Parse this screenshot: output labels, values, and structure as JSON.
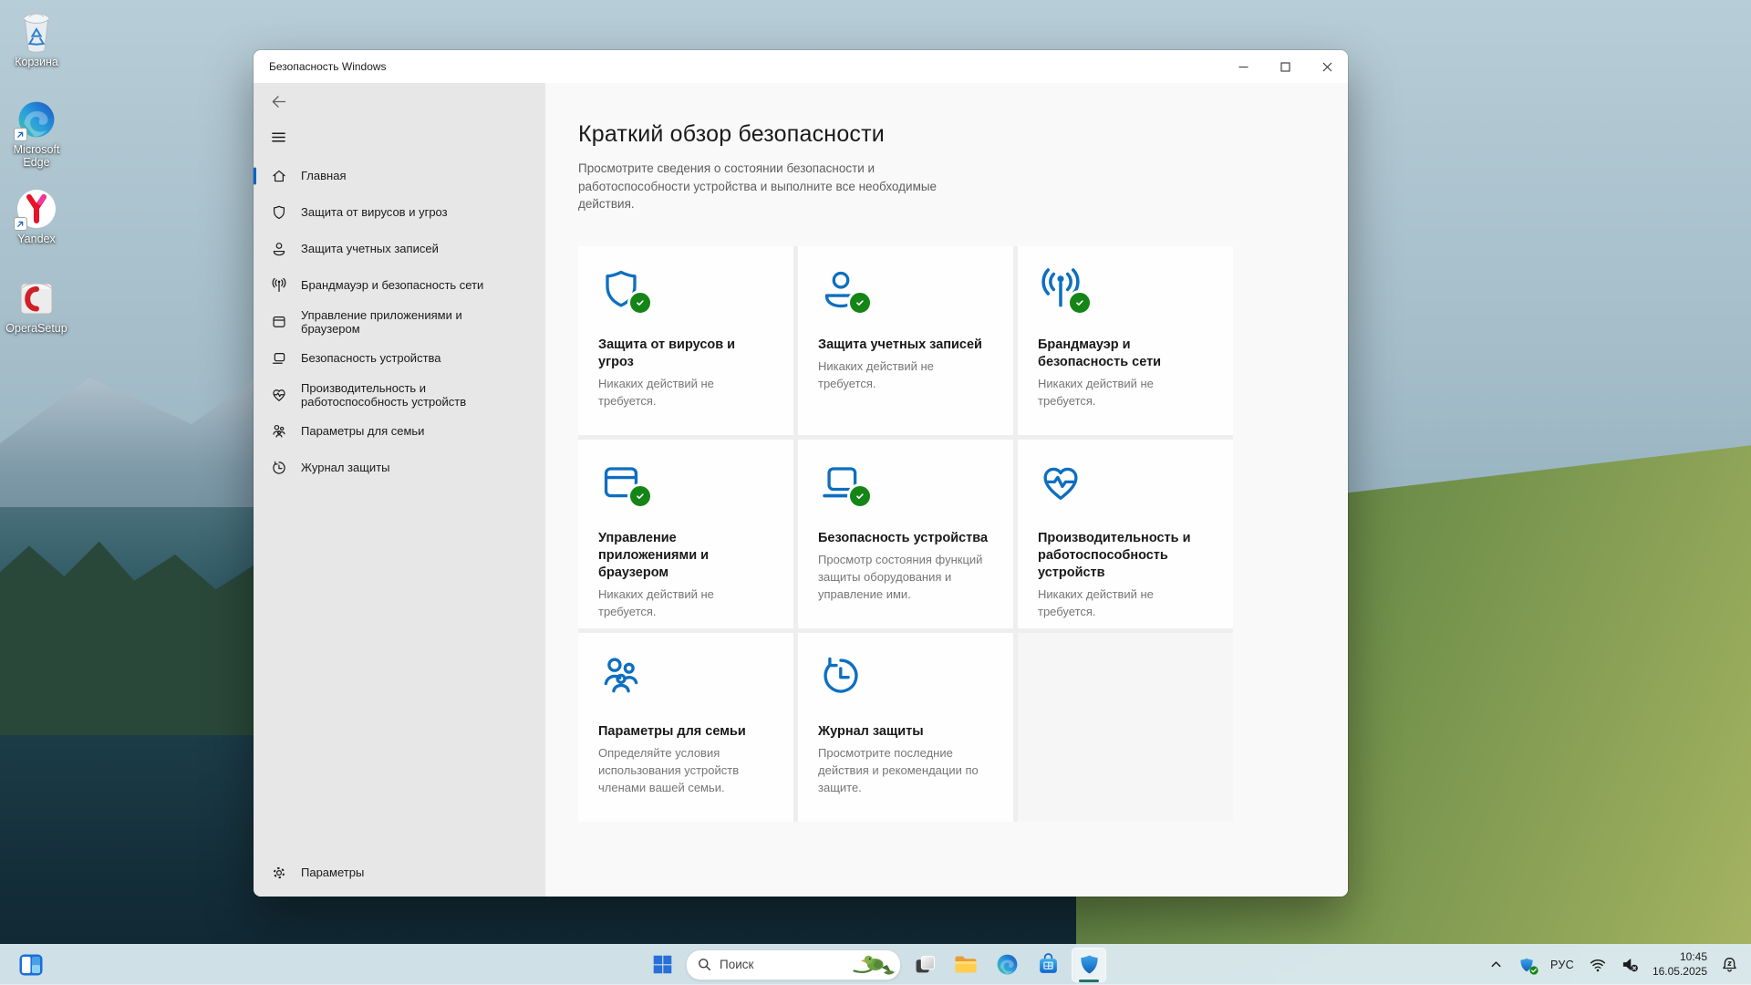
{
  "window": {
    "title": "Безопасность Windows",
    "sidebar": {
      "items": [
        {
          "label": "Главная",
          "icon": "home-icon",
          "selected": true
        },
        {
          "label": "Защита от вирусов и угроз",
          "icon": "virus-shield-icon",
          "selected": false
        },
        {
          "label": "Защита учетных записей",
          "icon": "account-icon",
          "selected": false
        },
        {
          "label": "Брандмауэр и безопасность сети",
          "icon": "firewall-antenna-icon",
          "selected": false
        },
        {
          "label": "Управление приложениями и\nбраузером",
          "icon": "app-browser-icon",
          "selected": false
        },
        {
          "label": "Безопасность устройства",
          "icon": "device-laptop-icon",
          "selected": false
        },
        {
          "label": "Производительность и\nработоспособность устройств",
          "icon": "health-heart-icon",
          "selected": false
        },
        {
          "label": "Параметры для семьи",
          "icon": "family-icon",
          "selected": false
        },
        {
          "label": "Журнал защиты",
          "icon": "history-clock-icon",
          "selected": false
        }
      ],
      "settings_label": "Параметры",
      "settings_icon": "gear-icon"
    },
    "main": {
      "heading": "Краткий обзор безопасности",
      "description": "Просмотрите сведения о состоянии безопасности и\nработоспособности устройства и выполните все необходимые\nдействия.",
      "cards": [
        {
          "title": "Защита от вирусов и угроз",
          "status": "Никаких действий не\nтребуется.",
          "icon": "virus-shield-icon",
          "check": true
        },
        {
          "title": "Защита учетных записей",
          "status": "Никаких действий не\nтребуется.",
          "icon": "account-icon",
          "check": true
        },
        {
          "title": "Брандмауэр и\nбезопасность сети",
          "status": "Никаких действий не\nтребуется.",
          "icon": "firewall-antenna-icon",
          "check": true
        },
        {
          "title": "Управление\nприложениями и\nбраузером",
          "status": "Никаких действий не\nтребуется.",
          "icon": "app-browser-icon",
          "check": true
        },
        {
          "title": "Безопасность устройства",
          "status": "Просмотр состояния функций\nзащиты оборудования и\nуправление ими.",
          "icon": "device-laptop-icon",
          "check": true
        },
        {
          "title": "Производительность и\nработоспособность\nустройств",
          "status": "Никаких действий не\nтребуется.",
          "icon": "health-heart-icon",
          "check": false
        },
        {
          "title": "Параметры для семьи",
          "status": "Определяйте условия\nиспользования устройств\nчленами вашей семьи.",
          "icon": "family-icon",
          "check": false
        },
        {
          "title": "Журнал защиты",
          "status": "Просмотрите последние\nдействия и рекомендации по\nзащите.",
          "icon": "history-clock-icon",
          "check": false
        }
      ]
    }
  },
  "desktop": {
    "icons": [
      {
        "label": "Корзина",
        "icon": "recycle-bin-icon"
      },
      {
        "label": "Microsoft\nEdge",
        "icon": "edge-icon"
      },
      {
        "label": "Yandex",
        "icon": "yandex-icon"
      },
      {
        "label": "OperaSetup",
        "icon": "opera-setup-icon"
      }
    ]
  },
  "taskbar": {
    "search_placeholder": "Поиск",
    "buttons": [
      "widgets",
      "start",
      "search",
      "task-view",
      "file-explorer",
      "edge",
      "store",
      "windows-security"
    ],
    "active_button": "windows-security",
    "tray": {
      "language": "РУС",
      "time": "10:45",
      "date": "16.05.2025"
    }
  },
  "colors": {
    "accent_blue": "#0067c0",
    "icon_blue": "#0d6fc0",
    "status_green": "#148516",
    "sidebar_bg": "#e7e7e7",
    "content_bg": "#f9f9f9",
    "taskbar_bg": "#dbeaf1"
  }
}
